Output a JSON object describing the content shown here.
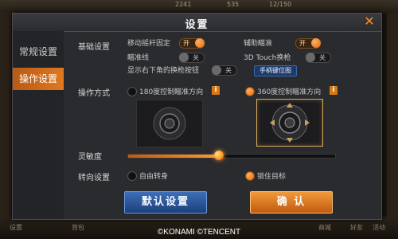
{
  "background": {
    "top_chips": [
      "2241",
      "535",
      "12/150"
    ],
    "bottom_tabs": [
      "设置",
      "背包",
      "商城",
      "好友",
      "活动"
    ]
  },
  "dialog": {
    "title": "设置",
    "close_icon": "close-icon",
    "sidebar": {
      "tabs": [
        {
          "label": "常规设置",
          "active": false
        },
        {
          "label": "操作设置",
          "active": true
        }
      ]
    },
    "basic": {
      "section_label": "基础设置",
      "rows": [
        {
          "label": "移动摇杆固定",
          "state": "开",
          "on": true
        },
        {
          "label": "辅助瞄准",
          "state": "开",
          "on": true
        },
        {
          "label": "瞄准线",
          "state": "关",
          "on": false
        },
        {
          "label": "3D Touch换枪",
          "state": "关",
          "on": false
        },
        {
          "label": "显示右下角的换枪按钮",
          "state": "关",
          "on": false
        }
      ],
      "handle_key_button": "手柄键位图"
    },
    "operation": {
      "section_label": "操作方式",
      "options": [
        {
          "label": "180度控制瞄准方向",
          "selected": false
        },
        {
          "label": "360度控制瞄准方向",
          "selected": true
        }
      ],
      "info_badge": "i"
    },
    "sensitivity": {
      "section_label": "灵敏度",
      "value": 0.44
    },
    "turn": {
      "section_label": "转向设置",
      "options": [
        {
          "label": "自由转身",
          "selected": false
        },
        {
          "label": "锁住目标",
          "selected": true
        }
      ]
    },
    "buttons": {
      "default": "默认设置",
      "confirm": "确 认"
    }
  },
  "copyright": "©KONAMI  ©TENCENT",
  "colors": {
    "accent": "#e07820",
    "primary_blue": "#2a5aa0"
  }
}
